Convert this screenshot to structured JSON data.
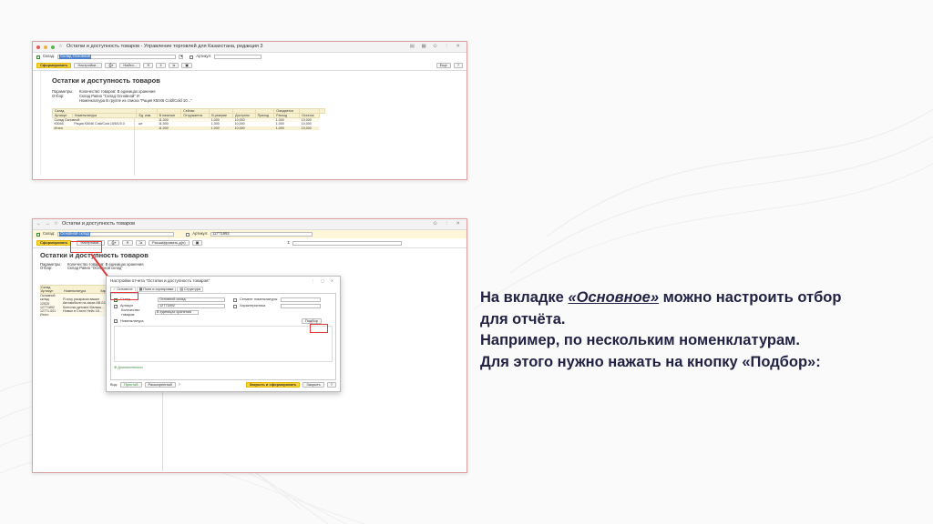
{
  "caption": {
    "line1_pre": "На вкладке ",
    "line1_em": "«Основное»",
    "line1_post": " можно настроить отбор",
    "line2": "для отчёта.",
    "line3": "Например, по нескольким номенклатурам.",
    "line4": "Для этого нужно нажать на кнопку «Подбор»:"
  },
  "shot1": {
    "window_title": "Остатки и доступность товаров - Управление торговлей для Казахстана, редакция 3",
    "warehouse_label": "Склад:",
    "warehouse_value": "Склад Основной",
    "article_label": "Артикул:",
    "btn_generate": "Сформировать",
    "btn_settings": "Настройки...",
    "btn_find": "Найти...",
    "btn_more": "Еще",
    "btn_help": "?",
    "report_title": "Остатки и доступность товаров",
    "params_label": "Параметры:",
    "params_value": "Количество товаров: В единицах хранения",
    "filter_label": "Отбор:",
    "filter_value1": "Склад Равно \"Склад Основной\" И",
    "filter_value2": "Номенклатура В группе из списка \"Рация К5046 Cold/Cold 10...\"",
    "hdr": [
      "Склад",
      "Артикул",
      "Номенклатура",
      "Ед. изм.",
      "Сейчас",
      "В наличии",
      "Отгружается",
      "В резерве",
      "Доступно",
      "Ожидается",
      "Приход",
      "Расход",
      "Остаток"
    ],
    "rows": [
      [
        "Склад Основной",
        "",
        "",
        "",
        "11,000",
        "",
        "1,000",
        "10,000",
        "",
        "1,000",
        "10,000"
      ],
      [
        "К5046",
        "Рация K5046 Cold/Cold 10/5/1/0.0",
        "шт",
        "11,000",
        "",
        "1,000",
        "10,000",
        "",
        "1,000",
        "10,000"
      ],
      [
        "Итого",
        "",
        "",
        "11,000",
        "",
        "1,000",
        "10,000",
        "",
        "1,000",
        "10,000"
      ]
    ]
  },
  "shot2": {
    "window_title": "Остатки и доступность товаров",
    "warehouse_label": "Склад:",
    "warehouse_value": "Основной склад",
    "article_label": "Артикул:",
    "article_value": "12771892",
    "btn_generate": "Сформировать",
    "btn_settings": "Настройки...",
    "btn_extra": "Расшифровать д(л)",
    "report_title": "Остатки и доступность товаров",
    "params_label": "Параметры:",
    "params_value": "Количество товаров: В единицах хранения",
    "filter_label": "Отбор:",
    "filter_value": "Склад Равно \"Основной склад\"",
    "hdr_warehouse": "Склад",
    "hdr_article": "Артикул",
    "hdr_nomen": "Номенклатура",
    "hdr_features": "Характеристи...",
    "left_rows": [
      "Основной склад",
      "12525",
      "12771892",
      "12771-001",
      "Итого"
    ],
    "mid_rows": [
      "Я хочу раскраски ваших",
      "Автомобили на заказ АВ-012",
      "Колготки детские Малыш...",
      "Новые в Стиле Нейс 18..."
    ]
  },
  "dialog": {
    "title": "Настройки отчета \"Остатки и доступность товаров\"",
    "tab_main": "Основное",
    "tab_fields": "Поля и сортировки",
    "tab_structure": "Структура",
    "wh_label": "Склад",
    "wh_value": "Основной склад",
    "seg_label": "Сегмент номенклатуры",
    "art_label": "Артикул",
    "art_value": "12771892",
    "char_label": "Характеристика",
    "qty_label": "Количество товаров:",
    "qty_value": "В единицах хранения",
    "nomen_label": "Номенклатура",
    "pick_button": "Подбор",
    "extra_link": "Дополнительно",
    "view_label": "Вид:",
    "view_simple": "Простой",
    "view_extended": "Расширенный",
    "close_generate": "Закрыть и сформировать",
    "close": "Закрыть",
    "help": "?"
  }
}
